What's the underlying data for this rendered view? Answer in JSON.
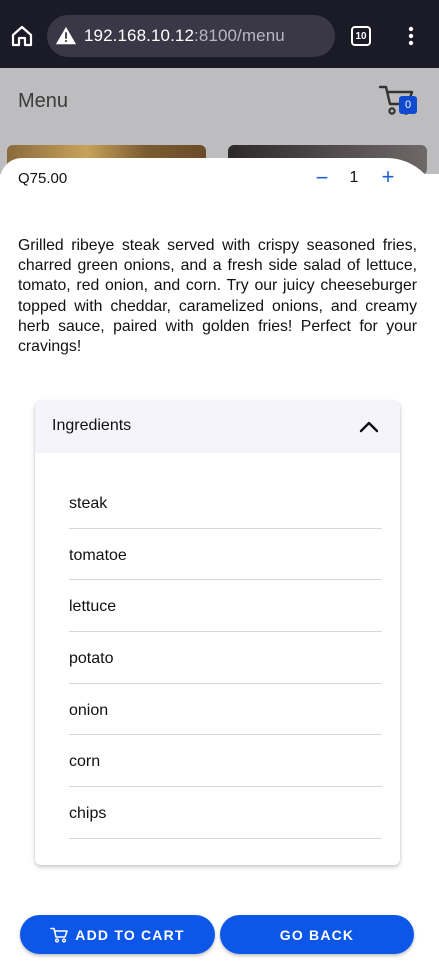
{
  "browser": {
    "url_host": "192.168.10.12",
    "url_port_path": ":8100/menu",
    "tab_count": "10",
    "icons": {
      "home": "home-icon",
      "warning": "warning-icon",
      "more": "more-vert-icon"
    }
  },
  "header": {
    "title": "Menu",
    "cart_count": "0",
    "cart_icon": "cart-icon"
  },
  "product": {
    "price": "Q75.00",
    "quantity": "1",
    "minus_symbol": "−",
    "plus_symbol": "+",
    "description": "Grilled ribeye steak served with crispy seasoned fries, charred green onions, and a fresh side salad of lettuce, tomato, red onion, and corn. Try our juicy cheeseburger topped with cheddar, caramelized onions, and creamy herb sauce, paired with golden fries! Perfect for your cravings!"
  },
  "ingredients": {
    "title": "Ingredients",
    "expanded": true,
    "items": [
      "steak",
      "tomatoe",
      "lettuce",
      "potato",
      "onion",
      "corn",
      "chips"
    ]
  },
  "actions": {
    "add_to_cart": "ADD TO CART",
    "go_back": "GO BACK"
  },
  "colors": {
    "accent": "#0c56e8",
    "badge": "#0f4ad0",
    "browser_bg": "#1b1a27",
    "header_bg": "#bdbdbf"
  }
}
